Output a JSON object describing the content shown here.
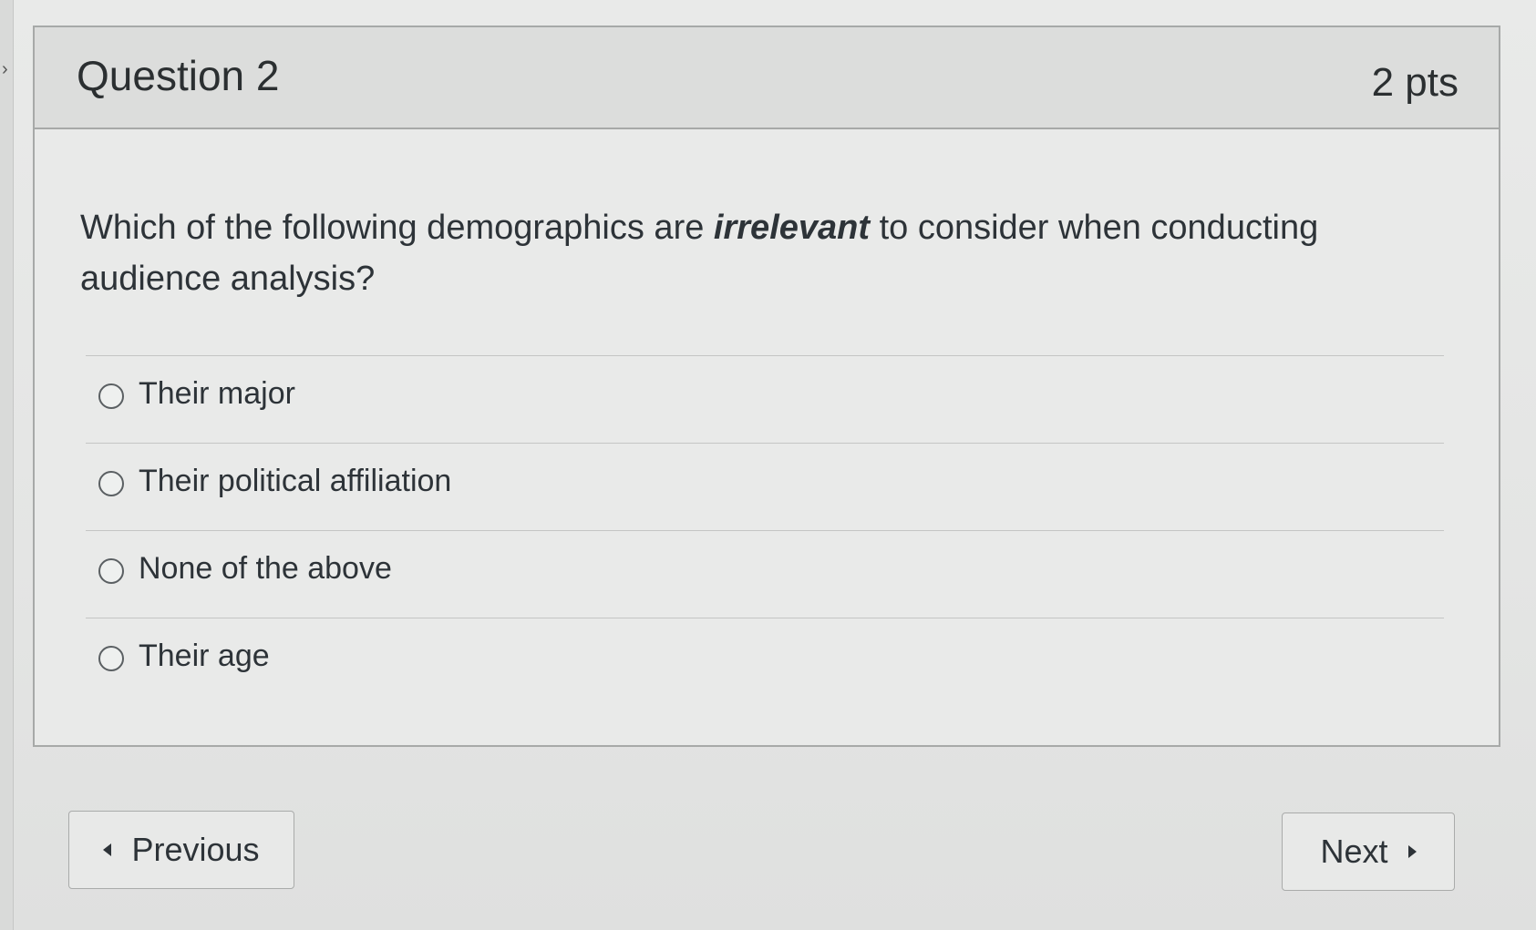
{
  "question": {
    "title": "Question 2",
    "points": "2 pts",
    "text_before": "Which of the following demographics are ",
    "text_emphasis": "irrelevant",
    "text_after": " to consider when conducting audience analysis?"
  },
  "answers": [
    {
      "label": "Their major"
    },
    {
      "label": "Their political affiliation"
    },
    {
      "label": "None of the above"
    },
    {
      "label": "Their age"
    }
  ],
  "navigation": {
    "previous_label": "Previous",
    "next_label": "Next"
  },
  "icons": {
    "previous": "caret-left-icon",
    "next": "caret-right-icon",
    "sidebar": "chevron-right-icon"
  }
}
